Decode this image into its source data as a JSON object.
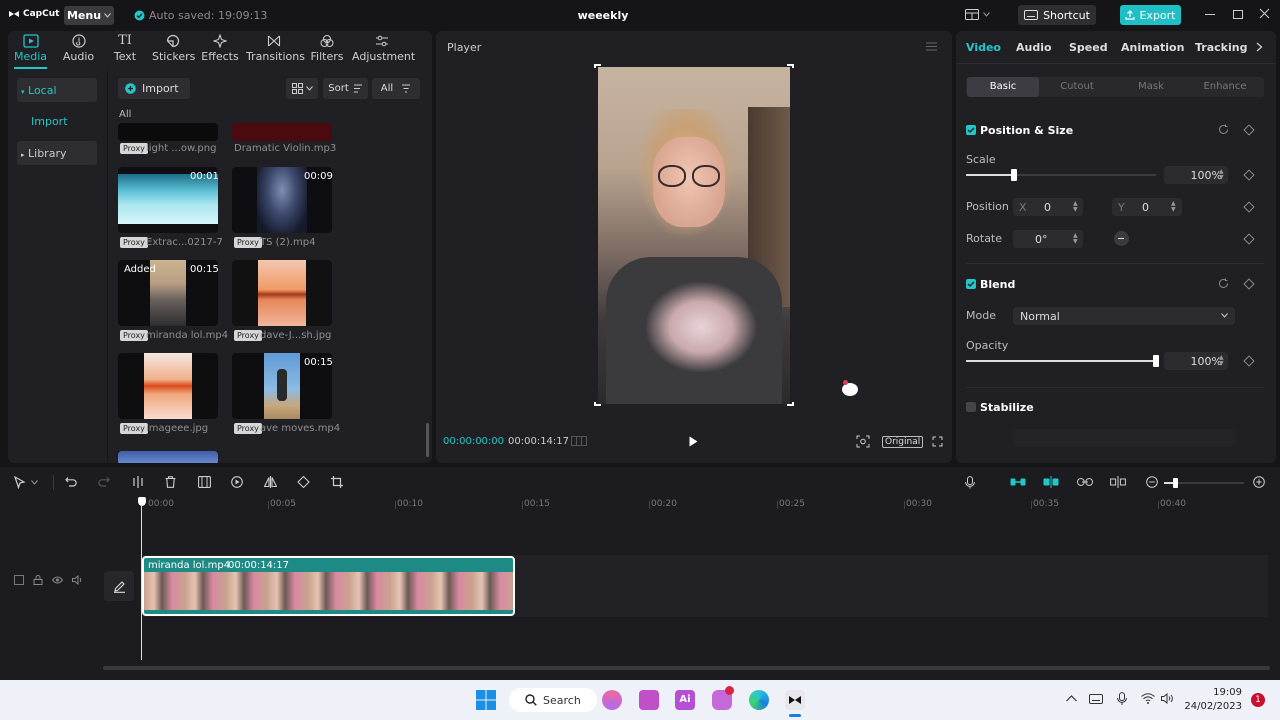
{
  "app": {
    "logo": "CapCut",
    "menu_label": "Menu",
    "autosave": "Auto saved: 19:09:13",
    "project_title": "weeekly",
    "shortcut_label": "Shortcut",
    "export_label": "Export"
  },
  "media_tabs": [
    {
      "label": "Media",
      "icon": "media-icon"
    },
    {
      "label": "Audio",
      "icon": "audio-icon"
    },
    {
      "label": "Text",
      "icon": "text-icon"
    },
    {
      "label": "Stickers",
      "icon": "stickers-icon"
    },
    {
      "label": "Effects",
      "icon": "effects-icon"
    },
    {
      "label": "Transitions",
      "icon": "transitions-icon"
    },
    {
      "label": "Filters",
      "icon": "filters-icon"
    },
    {
      "label": "Adjustment",
      "icon": "adjustment-icon"
    }
  ],
  "library_nav": {
    "local": "Local",
    "import": "Import",
    "library": "Library"
  },
  "media_toolbar": {
    "import_label": "Import",
    "sort_label": "Sort",
    "filter_label": "All",
    "section_label": "All"
  },
  "media_items": [
    {
      "name": "light ...ow.png",
      "proxy": "Proxy",
      "duration": ""
    },
    {
      "name": "Dramatic Violin.mp3",
      "proxy": "",
      "duration": ""
    },
    {
      "name": "Extrac...0217-7",
      "proxy": "Proxy",
      "duration": "00:01"
    },
    {
      "name": "TS (2).mp4",
      "proxy": "Proxy",
      "duration": "00:09"
    },
    {
      "name": "miranda lol.mp4",
      "proxy": "Proxy",
      "duration": "00:15",
      "badge": "Added"
    },
    {
      "name": "dave-J...sh.jpg",
      "proxy": "Proxy",
      "duration": ""
    },
    {
      "name": "imageee.jpg",
      "proxy": "Proxy",
      "duration": ""
    },
    {
      "name": "ave moves.mp4",
      "proxy": "Proxy",
      "duration": "00:15"
    }
  ],
  "player": {
    "title": "Player",
    "current_time": "00:00:00:00",
    "total_time": "00:00:14:17",
    "ratio_label": "Original"
  },
  "right_tabs": [
    "Video",
    "Audio",
    "Speed",
    "Animation",
    "Tracking"
  ],
  "sub_tabs": [
    "Basic",
    "Cutout",
    "Mask",
    "Enhance"
  ],
  "position_size": {
    "title": "Position & Size",
    "scale_label": "Scale",
    "scale_value": "100%",
    "scale_fraction": 0.25,
    "position_label": "Position",
    "x_label": "X",
    "x_value": "0",
    "y_label": "Y",
    "y_value": "0",
    "rotate_label": "Rotate",
    "rotate_value": "0°"
  },
  "blend": {
    "title": "Blend",
    "mode_label": "Mode",
    "mode_value": "Normal",
    "opacity_label": "Opacity",
    "opacity_value": "100%",
    "opacity_fraction": 1.0
  },
  "stabilize": {
    "title": "Stabilize"
  },
  "timeline": {
    "ticks": [
      "00:00",
      "00:05",
      "00:10",
      "00:15",
      "00:20",
      "00:25",
      "00:30",
      "00:35",
      "00:40"
    ],
    "clip_name": "miranda lol.mp4",
    "clip_duration": "00:00:14:17"
  },
  "taskbar": {
    "search_label": "Search",
    "time": "19:09",
    "date": "24/02/2023",
    "notification_count": "1"
  },
  "colors": {
    "accent": "#22c7c7",
    "export_bg": "#1fbfc6",
    "panel_bg": "#202024",
    "clip_bg": "#1e8a86"
  }
}
